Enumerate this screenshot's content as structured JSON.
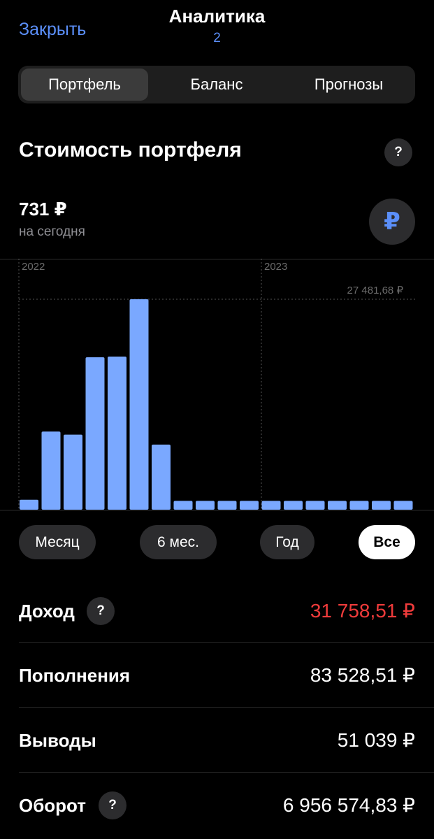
{
  "header": {
    "close_label": "Закрыть",
    "title": "Аналитика",
    "subtitle": "2"
  },
  "tabs": [
    {
      "label": "Портфель",
      "active": true
    },
    {
      "label": "Баланс",
      "active": false
    },
    {
      "label": "Прогнозы",
      "active": false
    }
  ],
  "portfolio": {
    "section_title": "Стоимость портфеля",
    "help_label": "?",
    "value": "731 ₽",
    "value_caption": "на сегодня",
    "currency_symbol": "₽"
  },
  "chart_data": {
    "type": "bar",
    "year_labels": [
      "2022",
      "2023"
    ],
    "max_label": "27 481,68 ₽",
    "max_value": 27481.68,
    "values": [
      1300,
      10200,
      9800,
      19900,
      20000,
      27481.68,
      8500,
      1150,
      1150,
      1150,
      1150,
      1150,
      1150,
      1150,
      1150,
      1150,
      1150,
      1150
    ],
    "bar_color": "#7aa8ff"
  },
  "ranges": [
    {
      "label": "Месяц",
      "active": false
    },
    {
      "label": "6 мес.",
      "active": false
    },
    {
      "label": "Год",
      "active": false
    },
    {
      "label": "Все",
      "active": true
    }
  ],
  "stats": {
    "income_label": "Доход",
    "income_value": "31 758,51 ₽",
    "deposits_label": "Пополнения",
    "deposits_value": "83 528,51 ₽",
    "withdrawals_label": "Выводы",
    "withdrawals_value": "51 039 ₽",
    "turnover_label": "Оборот",
    "turnover_value": "6 956 574,83 ₽",
    "help_label": "?"
  },
  "colors": {
    "accent": "#5b8ff9",
    "negative": "#ef3b3b",
    "bar": "#7aa8ff"
  }
}
